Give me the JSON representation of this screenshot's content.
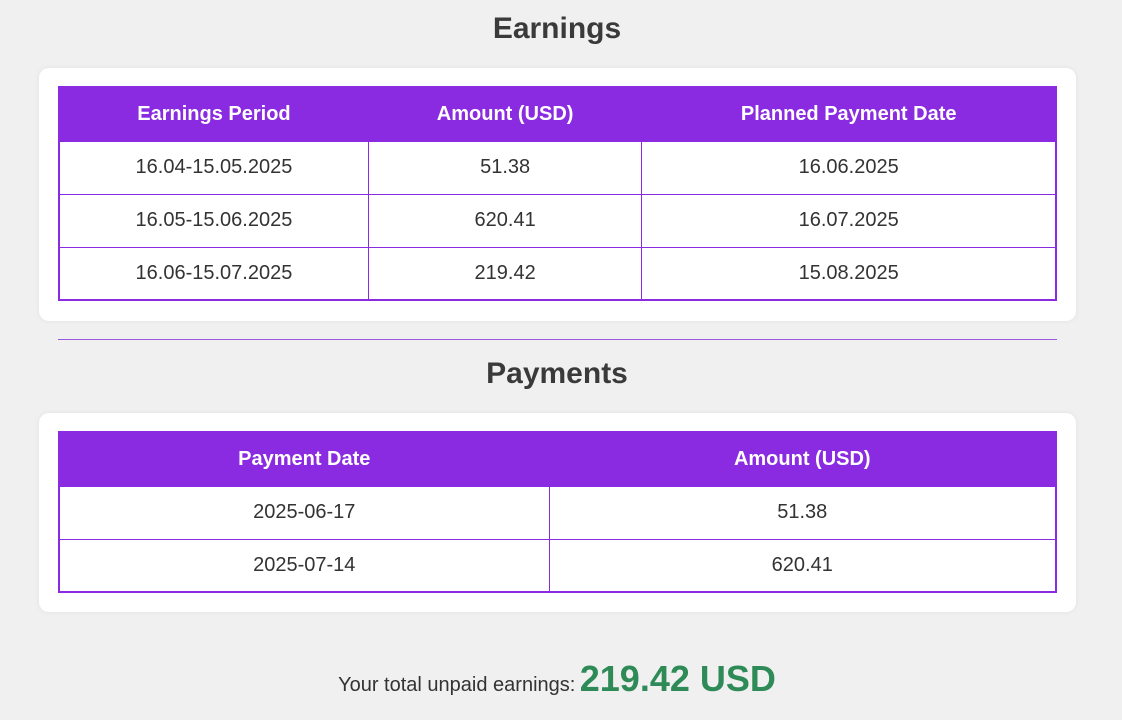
{
  "earnings": {
    "title": "Earnings",
    "columns": [
      "Earnings Period",
      "Amount (USD)",
      "Planned Payment Date"
    ],
    "rows": [
      [
        "16.04-15.05.2025",
        "51.38",
        "16.06.2025"
      ],
      [
        "16.05-15.06.2025",
        "620.41",
        "16.07.2025"
      ],
      [
        "16.06-15.07.2025",
        "219.42",
        "15.08.2025"
      ]
    ]
  },
  "payments": {
    "title": "Payments",
    "columns": [
      "Payment Date",
      "Amount (USD)"
    ],
    "rows": [
      [
        "2025-06-17",
        "51.38"
      ],
      [
        "2025-07-14",
        "620.41"
      ]
    ]
  },
  "total": {
    "label": "Your total unpaid earnings:",
    "value": "219.42 USD"
  },
  "colors": {
    "accent": "#8a2be2",
    "total_value": "#2e8b57",
    "background": "#f0f0f0"
  }
}
